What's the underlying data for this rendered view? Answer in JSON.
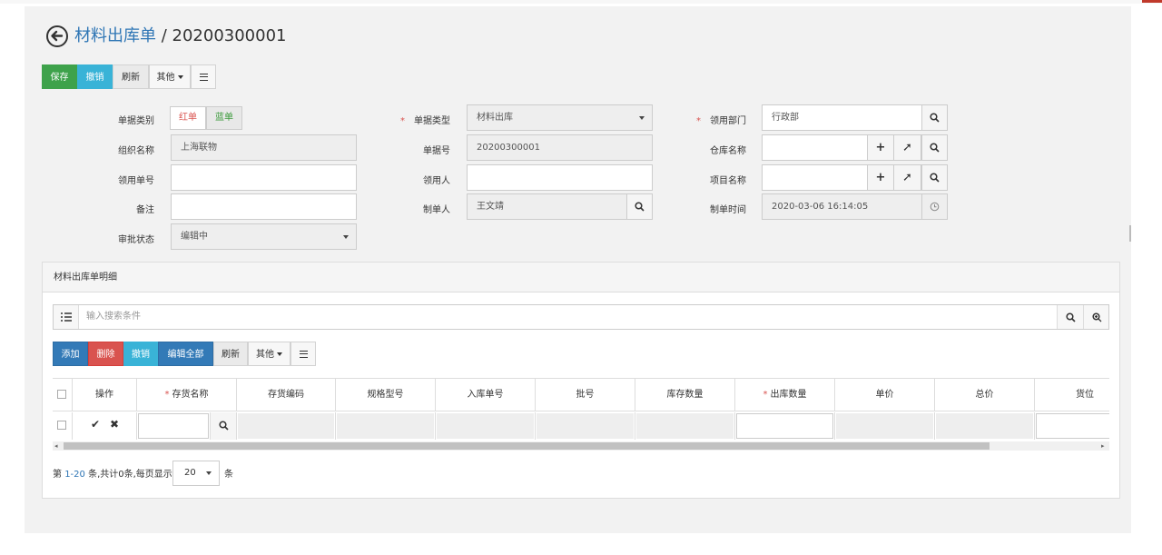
{
  "header": {
    "breadcrumb": "材料出库单",
    "separator": " / ",
    "doc_no": "20200300001"
  },
  "toolbar": {
    "save": "保存",
    "revoke": "撤销",
    "refresh": "刷新",
    "other": "其他"
  },
  "form": {
    "doc_category": {
      "label": "单据类别",
      "red": "红单",
      "blue": "蓝单"
    },
    "doc_type": {
      "label": "单据类型",
      "value": "材料出库"
    },
    "dept": {
      "label": "领用部门",
      "value": "行政部"
    },
    "org": {
      "label": "组织名称",
      "value": "上海联物"
    },
    "doc_number": {
      "label": "单据号",
      "value": "20200300001"
    },
    "warehouse": {
      "label": "仓库名称",
      "value": ""
    },
    "requisition_no": {
      "label": "领用单号",
      "value": ""
    },
    "recipient": {
      "label": "领用人",
      "value": ""
    },
    "project": {
      "label": "项目名称",
      "value": ""
    },
    "remark": {
      "label": "备注",
      "value": ""
    },
    "creator": {
      "label": "制单人",
      "value": "王文靖"
    },
    "created_at": {
      "label": "制单时间",
      "value": "2020-03-06 16:14:05"
    },
    "approval": {
      "label": "审批状态",
      "value": "编辑中"
    }
  },
  "detail": {
    "title": "材料出库单明细",
    "search_placeholder": "输入搜索条件",
    "toolbar": {
      "add": "添加",
      "delete": "删除",
      "revoke": "撤销",
      "edit_all": "编辑全部",
      "refresh": "刷新",
      "other": "其他"
    },
    "columns": [
      "操作",
      "存货名称",
      "存货编码",
      "规格型号",
      "入库单号",
      "批号",
      "库存数量",
      "出库数量",
      "单价",
      "总价",
      "货位"
    ],
    "pager": {
      "prefix": "第 ",
      "range": "1-20",
      "suffix": " 条,共计0条,每页显示",
      "page_size": "20",
      "unit": "条"
    }
  },
  "colors": {
    "green": "#3ea24b",
    "cyan": "#39b3d7",
    "blue": "#337ab7",
    "red": "#d9534f",
    "link": "#2f76b5"
  }
}
